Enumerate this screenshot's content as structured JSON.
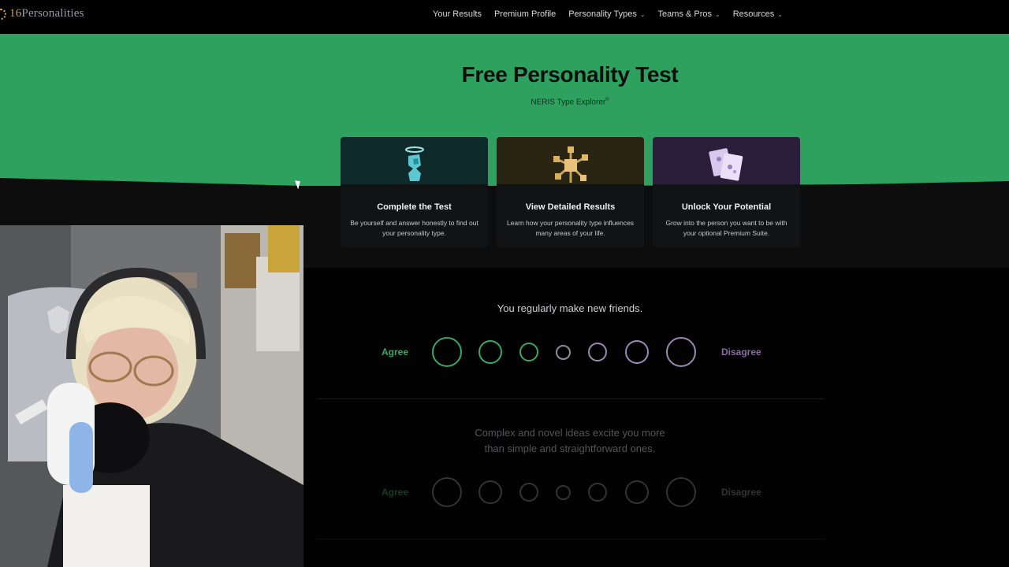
{
  "nav": {
    "brand_num": "16",
    "brand_text": "Personalities",
    "links": [
      {
        "label": "Your Results",
        "dropdown": false
      },
      {
        "label": "Premium Profile",
        "dropdown": false
      },
      {
        "label": "Personality Types",
        "dropdown": true
      },
      {
        "label": "Teams & Pros",
        "dropdown": true
      },
      {
        "label": "Resources",
        "dropdown": true
      }
    ]
  },
  "hero": {
    "title": "Free Personality Test",
    "subtitle": "NERIS Type Explorer",
    "subtitle_mark": "®",
    "color": "#2ea15f"
  },
  "cards": [
    {
      "title": "Complete the Test",
      "text": "Be yourself and answer honestly to find out your personality type.",
      "icon": "figure-halo-icon"
    },
    {
      "title": "View Detailed Results",
      "text": "Learn how your personality type influences many areas of your life.",
      "icon": "molecule-icon"
    },
    {
      "title": "Unlock Your Potential",
      "text": "Grow into the person you want to be with your optional Premium Suite.",
      "icon": "cards-icon"
    }
  ],
  "questions": [
    {
      "text": "You regularly make new friends.",
      "agree": "Agree",
      "disagree": "Disagree"
    },
    {
      "text_line1": "Complex and novel ideas excite you more",
      "text_line2": "than simple and straightforward ones.",
      "agree": "Agree",
      "disagree": "Disagree"
    }
  ],
  "colors": {
    "agree": "#3aa765",
    "disagree": "#8b6aa5",
    "neutral": "#8e8e94"
  }
}
